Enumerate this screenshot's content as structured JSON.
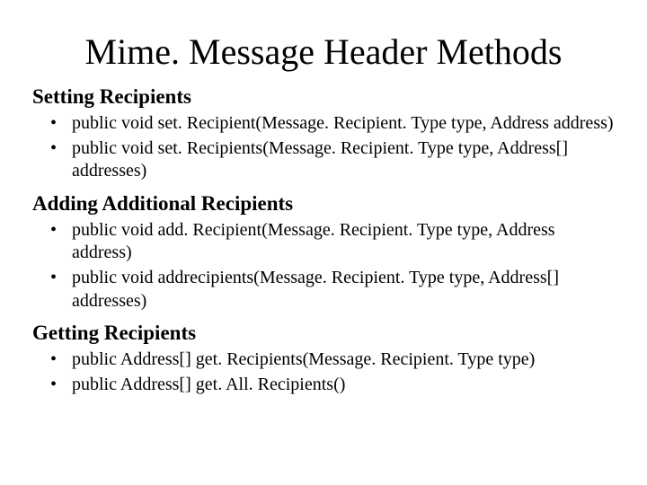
{
  "title": "Mime. Message Header Methods",
  "sections": [
    {
      "heading": "Setting Recipients",
      "items": [
        "public void set. Recipient(Message. Recipient. Type type, Address address)",
        "public void set. Recipients(Message. Recipient. Type type, Address[] addresses)"
      ]
    },
    {
      "heading": "Adding Additional Recipients",
      "items": [
        "public void add. Recipient(Message. Recipient. Type type, Address address)",
        "public void addrecipients(Message. Recipient. Type type, Address[] addresses)"
      ]
    },
    {
      "heading": "Getting Recipients",
      "items": [
        "public Address[] get. Recipients(Message. Recipient. Type type)",
        "public Address[] get. All. Recipients()"
      ]
    }
  ]
}
